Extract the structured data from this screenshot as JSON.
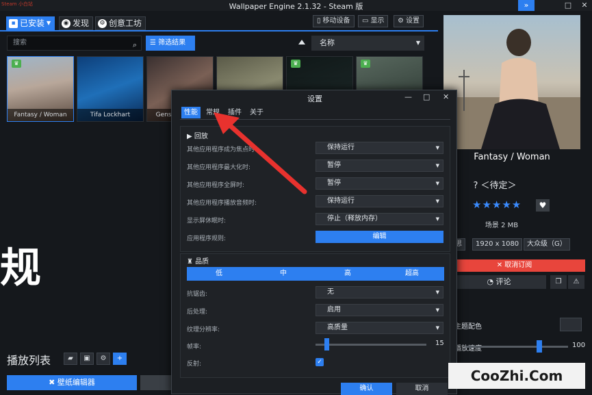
{
  "window": {
    "title": "Wallpaper Engine 2.1.32 - Steam 版",
    "brand": "Steam 小白站",
    "controls": [
      "»",
      "□",
      "✕"
    ]
  },
  "top_tabs": [
    {
      "label": "已安装",
      "icon": "installed-icon"
    },
    {
      "label": "发现",
      "icon": "compass-icon"
    },
    {
      "label": "创意工坊",
      "icon": "steam-icon"
    }
  ],
  "toolbar": {
    "mobile": "移动设备",
    "display": "显示",
    "settings": "设置"
  },
  "search": {
    "placeholder": "搜索"
  },
  "filter": {
    "label": "筛选结果"
  },
  "sort": {
    "label": "名称"
  },
  "thumbnails": [
    {
      "caption": "Fantasy / Woman"
    },
    {
      "caption": "Tifa Lockhart"
    },
    {
      "caption": "Genshin Impact"
    },
    {
      "caption": ""
    },
    {
      "caption": ""
    },
    {
      "caption": ""
    }
  ],
  "overlay_text": "规",
  "playlist": {
    "label": "播放列表",
    "editor_button": "壁纸编辑器"
  },
  "settings_dialog": {
    "title": "设置",
    "tabs": [
      "性能",
      "常规",
      "插件",
      "关于"
    ],
    "playback": {
      "heading": "回放",
      "rows": [
        {
          "label": "其他应用程序成为焦点时:",
          "value": "保持运行"
        },
        {
          "label": "其他应用程序最大化时:",
          "value": "暂停"
        },
        {
          "label": "其他应用程序全屏时:",
          "value": "暂停"
        },
        {
          "label": "其他应用程序播放音频时:",
          "value": "保持运行"
        },
        {
          "label": "显示屏休眠时:",
          "value": "停止（释放内存）"
        }
      ],
      "app_rules_label": "应用程序规则:",
      "edit_button": "编辑"
    },
    "quality": {
      "heading": "品质",
      "levels": [
        "低",
        "中",
        "高",
        "超高"
      ],
      "antialiasing": {
        "label": "抗锯齿:",
        "value": "无"
      },
      "postprocessing": {
        "label": "后处理:",
        "value": "启用"
      },
      "render_resolution": {
        "label": "纹理分辨率:",
        "value": "高质量"
      },
      "fps": {
        "label": "帧率:",
        "value": "15",
        "fraction": 0.1
      },
      "reflection": {
        "label": "反射:",
        "checked": true
      }
    },
    "ok": "确认",
    "cancel": "取消"
  },
  "detail": {
    "title": "Fantasy / Woman",
    "rating_label": "? ＜待定＞",
    "stars": "★★★★★",
    "size": "场景 2 MB",
    "tags": [
      "思",
      "1920 x 1080",
      "大众级（G）"
    ],
    "unsubscribe": "✕ 取消订阅",
    "review": "评论",
    "scheme_color": "主题配色",
    "speed_label": "播放速度",
    "speed_value": "100",
    "speed_fraction": 0.72
  },
  "watermark": "CooZhi.Com"
}
